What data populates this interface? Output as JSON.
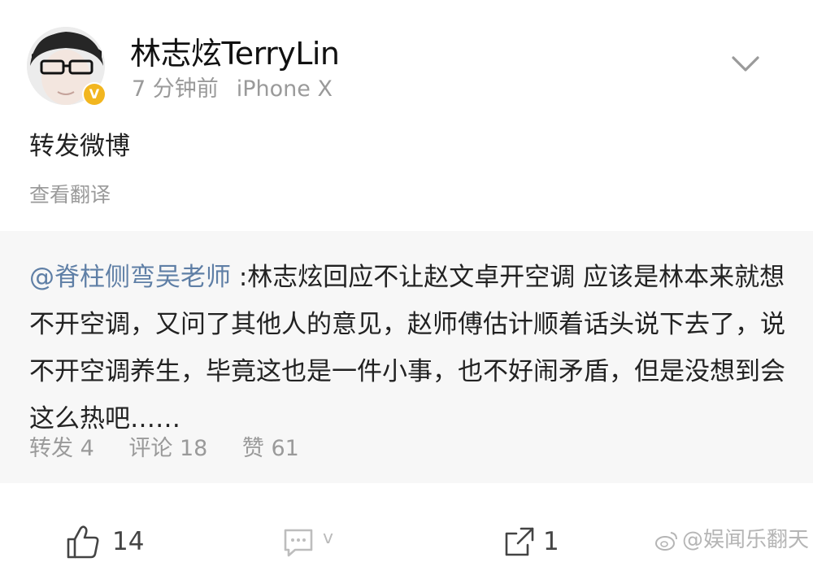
{
  "post": {
    "username": "林志炫TerryLin",
    "time": "7 分钟前",
    "device": "iPhone X",
    "verified_badge": "V",
    "text": "转发微博",
    "translate_link": "查看翻译"
  },
  "repost": {
    "mention": "@脊柱侧弯吴老师",
    "body": " :林志炫回应不让赵文卓开空调 应该是林本来就想不开空调，又问了其他人的意见，赵师傅估计顺着话头说下去了，说不开空调养生，毕竟这也是一件小事，也不好闹矛盾，但是没想到会这么热吧……",
    "stats": {
      "repost": "转发 4",
      "comment": "评论 18",
      "like": "赞 61"
    }
  },
  "action_bar": {
    "like_count": "14",
    "comment_count": "v",
    "repost_count": "1",
    "watermark": "@娱闻乐翻天"
  },
  "icons": [
    "chevron-down-icon",
    "like-icon",
    "comment-icon",
    "repost-icon",
    "weibo-logo-icon"
  ],
  "colors": {
    "mention": "#5f7fa6",
    "muted_text": "#9a9a9a",
    "repost_background": "#f7f7f7",
    "verified_badge": "#f2b61f"
  }
}
